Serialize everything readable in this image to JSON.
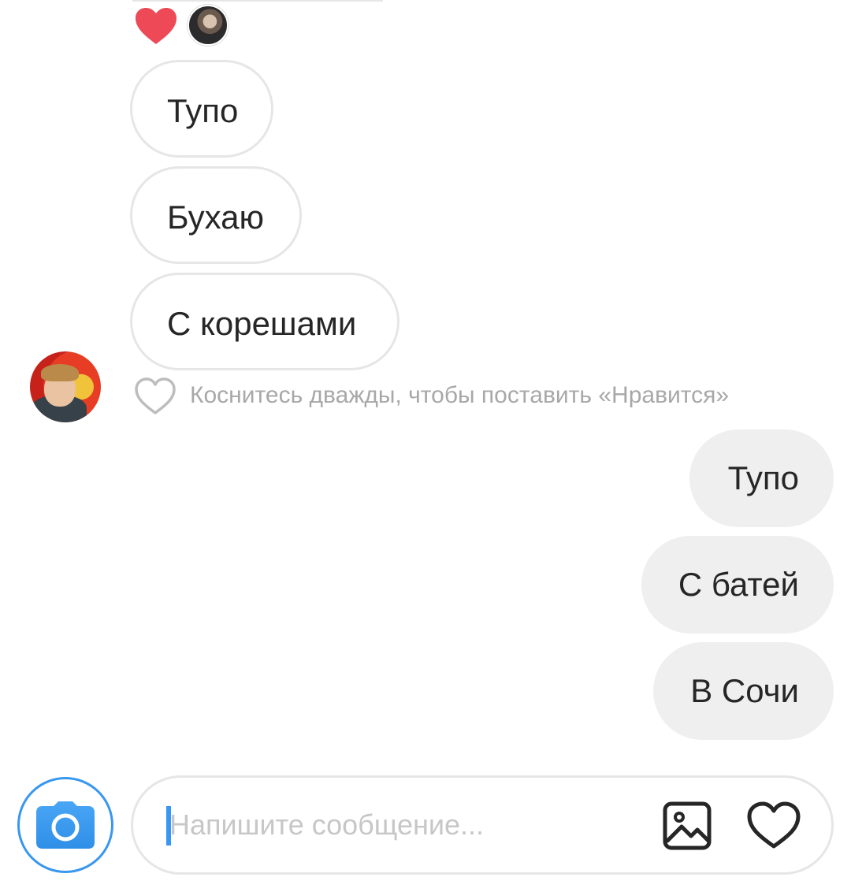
{
  "reactions": {
    "icon": "heart-filled-icon",
    "color": "#ed4956"
  },
  "incoming": {
    "messages": [
      "Тупо",
      "Бухаю",
      "С корешами"
    ],
    "like_hint": "Коснитесь дважды, чтобы поставить «Нравится»"
  },
  "outgoing": {
    "messages": [
      "Тупо",
      "С батей",
      "В Сочи"
    ]
  },
  "composer": {
    "placeholder": "Напишите сообщение...",
    "value": "",
    "camera_icon": "camera-icon",
    "gallery_icon": "gallery-icon",
    "like_icon": "heart-outline-icon"
  },
  "colors": {
    "accent": "#3897f0",
    "bubble_out": "#efefef",
    "bubble_in_border": "#e6e6e6",
    "hint_text": "#a8a8a8"
  }
}
